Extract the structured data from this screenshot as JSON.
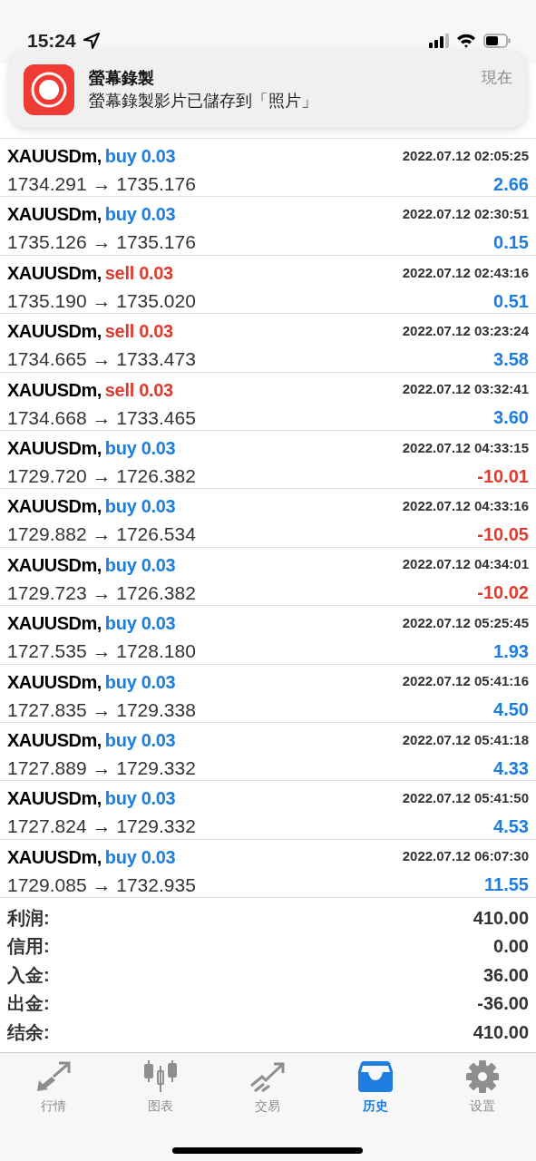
{
  "status_bar": {
    "time": "15:24"
  },
  "notification": {
    "app": "螢幕錄製",
    "message": "螢幕錄製影片已儲存到「照片」",
    "time": "現在"
  },
  "deals": [
    {
      "symbol": "XAUUSDm,",
      "order": "buy 0.03",
      "kind": "buy",
      "time": "2022.07.12 02:05:25",
      "prices": "1734.291 → 1735.176",
      "profit": "2.66",
      "negative": false
    },
    {
      "symbol": "XAUUSDm,",
      "order": "buy 0.03",
      "kind": "buy",
      "time": "2022.07.12 02:30:51",
      "prices": "1735.126 → 1735.176",
      "profit": "0.15",
      "negative": false
    },
    {
      "symbol": "XAUUSDm,",
      "order": "sell 0.03",
      "kind": "sell",
      "time": "2022.07.12 02:43:16",
      "prices": "1735.190 → 1735.020",
      "profit": "0.51",
      "negative": false
    },
    {
      "symbol": "XAUUSDm,",
      "order": "sell 0.03",
      "kind": "sell",
      "time": "2022.07.12 03:23:24",
      "prices": "1734.665 → 1733.473",
      "profit": "3.58",
      "negative": false
    },
    {
      "symbol": "XAUUSDm,",
      "order": "sell 0.03",
      "kind": "sell",
      "time": "2022.07.12 03:32:41",
      "prices": "1734.668 → 1733.465",
      "profit": "3.60",
      "negative": false
    },
    {
      "symbol": "XAUUSDm,",
      "order": "buy 0.03",
      "kind": "buy",
      "time": "2022.07.12 04:33:15",
      "prices": "1729.720 → 1726.382",
      "profit": "-10.01",
      "negative": true
    },
    {
      "symbol": "XAUUSDm,",
      "order": "buy 0.03",
      "kind": "buy",
      "time": "2022.07.12 04:33:16",
      "prices": "1729.882 → 1726.534",
      "profit": "-10.05",
      "negative": true
    },
    {
      "symbol": "XAUUSDm,",
      "order": "buy 0.03",
      "kind": "buy",
      "time": "2022.07.12 04:34:01",
      "prices": "1729.723 → 1726.382",
      "profit": "-10.02",
      "negative": true
    },
    {
      "symbol": "XAUUSDm,",
      "order": "buy 0.03",
      "kind": "buy",
      "time": "2022.07.12 05:25:45",
      "prices": "1727.535 → 1728.180",
      "profit": "1.93",
      "negative": false
    },
    {
      "symbol": "XAUUSDm,",
      "order": "buy 0.03",
      "kind": "buy",
      "time": "2022.07.12 05:41:16",
      "prices": "1727.835 → 1729.338",
      "profit": "4.50",
      "negative": false
    },
    {
      "symbol": "XAUUSDm,",
      "order": "buy 0.03",
      "kind": "buy",
      "time": "2022.07.12 05:41:18",
      "prices": "1727.889 → 1729.332",
      "profit": "4.33",
      "negative": false
    },
    {
      "symbol": "XAUUSDm,",
      "order": "buy 0.03",
      "kind": "buy",
      "time": "2022.07.12 05:41:50",
      "prices": "1727.824 → 1729.332",
      "profit": "4.53",
      "negative": false
    },
    {
      "symbol": "XAUUSDm,",
      "order": "buy 0.03",
      "kind": "buy",
      "time": "2022.07.12 06:07:30",
      "prices": "1729.085 → 1732.935",
      "profit": "11.55",
      "negative": false
    }
  ],
  "summary": [
    {
      "label": "利润:",
      "value": "410.00"
    },
    {
      "label": "信用:",
      "value": "0.00"
    },
    {
      "label": "入金:",
      "value": "36.00"
    },
    {
      "label": "出金:",
      "value": "-36.00"
    },
    {
      "label": "结余:",
      "value": "410.00"
    }
  ],
  "tabs": [
    {
      "label": "行情",
      "selected": false
    },
    {
      "label": "图表",
      "selected": false
    },
    {
      "label": "交易",
      "selected": false
    },
    {
      "label": "历史",
      "selected": true
    },
    {
      "label": "设置",
      "selected": false
    }
  ]
}
